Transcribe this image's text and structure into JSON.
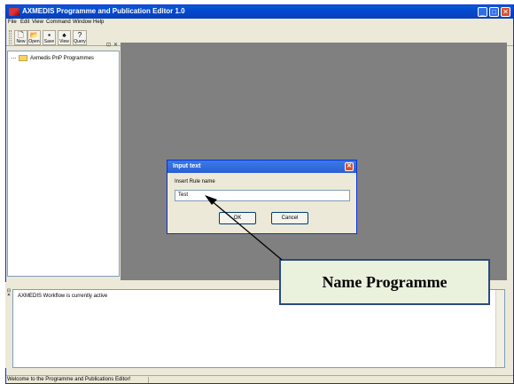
{
  "window": {
    "title": "AXMEDIS Programme and Publication Editor 1.0",
    "controls": [
      "_",
      "□",
      "✕"
    ]
  },
  "menu": [
    "File",
    "Edit",
    "View",
    "Command",
    "Window",
    "Help"
  ],
  "toolbar": {
    "buttons": [
      {
        "label": "New",
        "icon": "new-document-icon",
        "glyph": "🗋"
      },
      {
        "label": "Open",
        "icon": "open-folder-icon",
        "glyph": "📂"
      },
      {
        "label": "Save",
        "icon": "save-disk-icon",
        "glyph": "▪"
      },
      {
        "label": "View",
        "icon": "binoculars-icon",
        "glyph": "♠"
      },
      {
        "label": "Query",
        "icon": "query-icon",
        "glyph": "?"
      }
    ]
  },
  "left_panel": {
    "controls": [
      "⊡",
      "✕"
    ],
    "tree": [
      {
        "label": "Axmedis PnP Programmes",
        "icon": "folder-icon"
      }
    ]
  },
  "dialog": {
    "title": "Input text",
    "prompt": "Insert Rule name",
    "input_value": "Test",
    "ok_label": "OK",
    "cancel_label": "Cancel"
  },
  "output_panel": {
    "grip": [
      "⊡",
      "✕"
    ],
    "lines": [
      "AXMEDIS Workflow is currently active"
    ]
  },
  "status_bar": {
    "text": "Welcome to the Programme and Publications Editor!"
  },
  "annotation": {
    "label": "Name Programme"
  },
  "colors": {
    "title_bar": "#0a5ad6",
    "mdi_background": "#808080",
    "callout_fill": "#eaf1dd",
    "callout_border": "#2a4a7f"
  }
}
